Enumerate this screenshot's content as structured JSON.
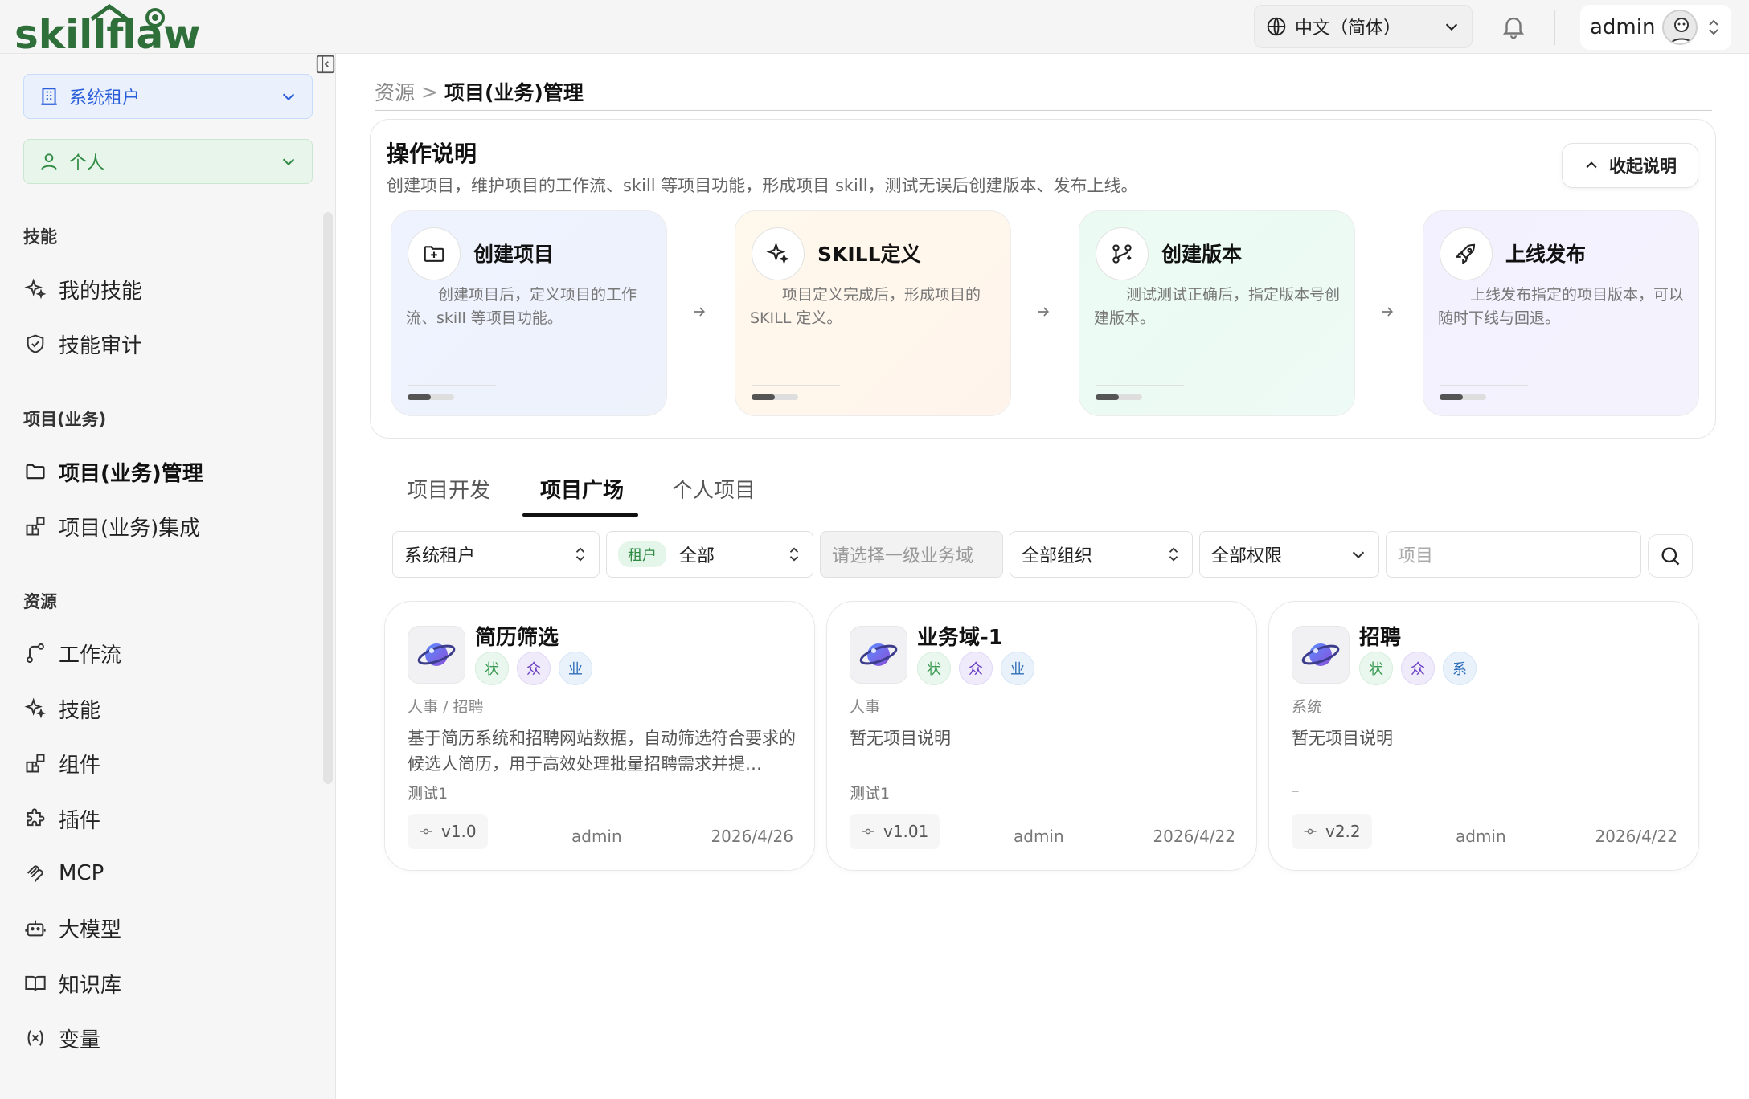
{
  "header": {
    "logo_text": "skillflaw",
    "language": "中文（简体）",
    "user_name": "admin"
  },
  "sidebar": {
    "tenant_select": "系统租户",
    "scope_select": "个人",
    "sections": [
      {
        "title": "技能",
        "items": [
          {
            "label": "我的技能",
            "icon": "sparkle-icon"
          },
          {
            "label": "技能审计",
            "icon": "shield-icon"
          }
        ]
      },
      {
        "title": "项目(业务)",
        "items": [
          {
            "label": "项目(业务)管理",
            "icon": "folder-icon",
            "active": true
          },
          {
            "label": "项目(业务)集成",
            "icon": "blocks-icon"
          }
        ]
      },
      {
        "title": "资源",
        "items": [
          {
            "label": "工作流",
            "icon": "workflow-icon"
          },
          {
            "label": "技能",
            "icon": "sparkle-icon"
          },
          {
            "label": "组件",
            "icon": "blocks-icon"
          },
          {
            "label": "插件",
            "icon": "puzzle-icon"
          },
          {
            "label": "MCP",
            "icon": "mcp-icon"
          },
          {
            "label": "大模型",
            "icon": "bot-icon"
          },
          {
            "label": "知识库",
            "icon": "book-icon"
          },
          {
            "label": "变量",
            "icon": "variable-icon"
          }
        ]
      }
    ]
  },
  "breadcrumb": {
    "parent": "资源",
    "separator": ">",
    "current": "项目(业务)管理"
  },
  "guide": {
    "title": "操作说明",
    "description": "创建项目，维护项目的工作流、skill 等项目功能，形成项目 skill，测试无误后创建版本、发布上线。",
    "collapse_label": "收起说明",
    "steps": [
      {
        "title": "创建项目",
        "desc": "创建项目后，定义项目的工作流、skill 等项目功能。",
        "icon": "folder-plus-icon",
        "progress": 0.5
      },
      {
        "title": "SKILL定义",
        "desc": "项目定义完成后，形成项目的 SKILL 定义。",
        "icon": "sparkle-icon",
        "progress": 0.5
      },
      {
        "title": "创建版本",
        "desc": "测试测试正确后，指定版本号创建版本。",
        "icon": "git-branch-icon",
        "progress": 0.5
      },
      {
        "title": "上线发布",
        "desc": "上线发布指定的项目版本，可以随时下线与回退。",
        "icon": "rocket-icon",
        "progress": 0.5
      }
    ]
  },
  "tabs": [
    {
      "label": "项目开发",
      "active": false
    },
    {
      "label": "项目广场",
      "active": true
    },
    {
      "label": "个人项目",
      "active": false
    }
  ],
  "filters": {
    "tenant": "系统租户",
    "tenant_badge": "租户",
    "tenant_scope": "全部",
    "domain_placeholder": "请选择一级业务域",
    "org": "全部组织",
    "permission": "全部权限",
    "search_placeholder": "项目"
  },
  "projects": [
    {
      "name": "简历筛选",
      "tags": [
        "状",
        "众",
        "业"
      ],
      "path": "人事 / 招聘",
      "description": "基于简历系统和招聘网站数据，自动筛选符合要求的候选人简历，用于高效处理批量招聘需求并提…",
      "extra": "测试1",
      "version": "v1.0",
      "owner": "admin",
      "date": "2026/4/26"
    },
    {
      "name": "业务域-1",
      "tags": [
        "状",
        "众",
        "业"
      ],
      "path": "人事",
      "description": "暂无项目说明",
      "extra": "测试1",
      "version": "v1.01",
      "owner": "admin",
      "date": "2026/4/22"
    },
    {
      "name": "招聘",
      "tags": [
        "状",
        "众",
        "系"
      ],
      "path": "系统",
      "description": "暂无项目说明",
      "extra": "–",
      "version": "v2.2",
      "owner": "admin",
      "date": "2026/4/22"
    }
  ]
}
